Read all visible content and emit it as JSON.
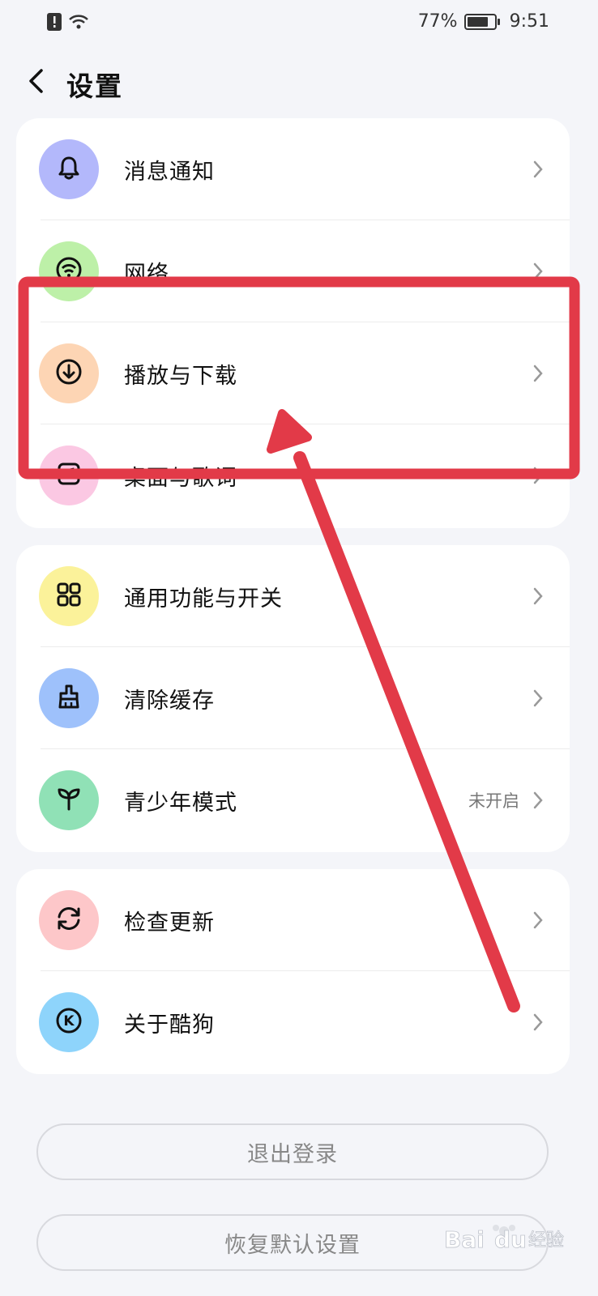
{
  "status_bar": {
    "battery_percent": "77%",
    "battery_level": 0.77,
    "time": "9:51",
    "icons": [
      "alert-icon",
      "wifi-icon",
      "battery-icon"
    ]
  },
  "header": {
    "title": "设置",
    "back_icon": "chevron-left-icon"
  },
  "groups": [
    {
      "items": [
        {
          "label": "消息通知",
          "icon": "bell-icon",
          "color": "#b3b8fb"
        },
        {
          "label": "网络",
          "icon": "wifi-icon",
          "color": "#bdf0a8"
        },
        {
          "label": "播放与下载",
          "icon": "download-icon",
          "color": "#fdd5b4"
        },
        {
          "label": "桌面与歌词",
          "icon": "lyrics-icon",
          "color": "#fbc8e3"
        }
      ]
    },
    {
      "items": [
        {
          "label": "通用功能与开关",
          "icon": "grid-icon",
          "color": "#fbf29a"
        },
        {
          "label": "清除缓存",
          "icon": "broom-icon",
          "color": "#9ec1fb"
        },
        {
          "label": "青少年模式",
          "icon": "sprout-icon",
          "color": "#90e1b6",
          "status": "未开启"
        }
      ]
    },
    {
      "items": [
        {
          "label": "检查更新",
          "icon": "refresh-icon",
          "color": "#fdc7c9"
        },
        {
          "label": "关于酷狗",
          "icon": "kugou-logo-icon",
          "color": "#8ed4fb"
        }
      ]
    }
  ],
  "buttons": {
    "logout": "退出登录",
    "restore_defaults": "恢复默认设置"
  },
  "annotation": {
    "color": "#e23a48",
    "highlighted_item": "播放与下载"
  },
  "watermark": {
    "text": "Baidu经验"
  }
}
